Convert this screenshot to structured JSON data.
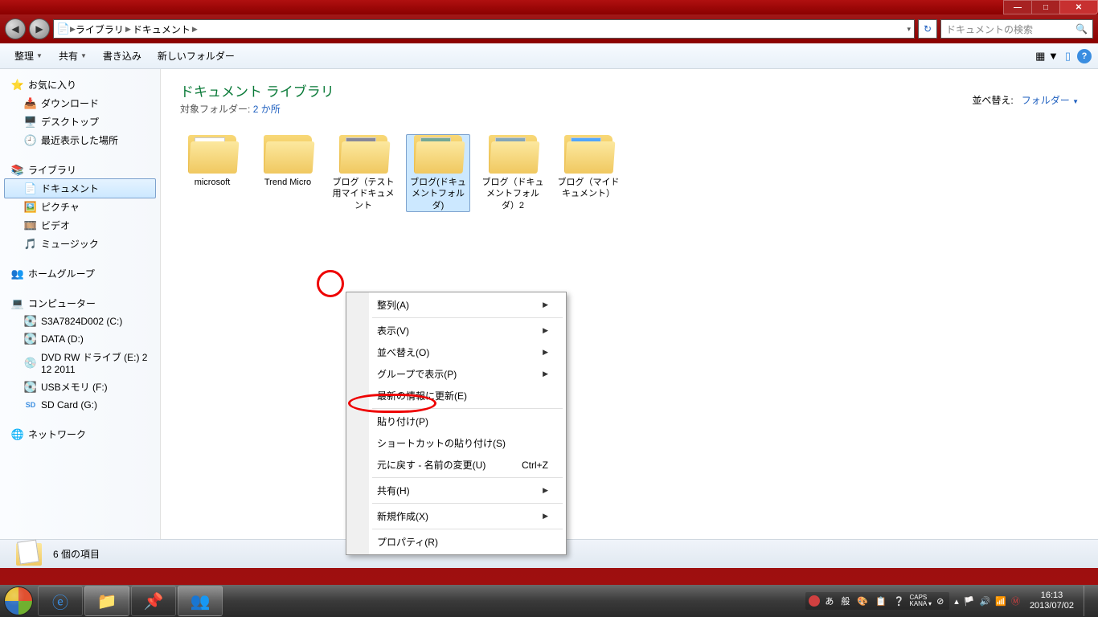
{
  "window_controls": {
    "min": "—",
    "max": "□",
    "close": "✕"
  },
  "nav": {
    "back": "◀",
    "fwd": "▶"
  },
  "breadcrumb": [
    "ライブラリ",
    "ドキュメント"
  ],
  "search_placeholder": "ドキュメントの検索",
  "toolbar": {
    "organize": "整理",
    "share": "共有",
    "burn": "書き込み",
    "newfolder": "新しいフォルダー"
  },
  "sidebar": {
    "favorites": {
      "label": "お気に入り",
      "items": [
        "ダウンロード",
        "デスクトップ",
        "最近表示した場所"
      ]
    },
    "libraries": {
      "label": "ライブラリ",
      "items": [
        "ドキュメント",
        "ピクチャ",
        "ビデオ",
        "ミュージック"
      ]
    },
    "homegroup": "ホームグループ",
    "computer": {
      "label": "コンピューター",
      "items": [
        "S3A7824D002 (C:)",
        "DATA (D:)",
        "DVD RW ドライブ (E:) 2 12 2011",
        "USBメモリ (F:)",
        "SD Card (G:)"
      ]
    },
    "network": "ネットワーク"
  },
  "library": {
    "title": "ドキュメント ライブラリ",
    "subtitle_label": "対象フォルダー:",
    "subtitle_link": "2 か所",
    "sort_label": "並べ替え:",
    "sort_value": "フォルダー"
  },
  "folders": [
    {
      "name": "microsoft"
    },
    {
      "name": "Trend Micro"
    },
    {
      "name": "ブログ（テスト用マイドキュメント"
    },
    {
      "name": "ブログ(ドキュメントフォルダ)"
    },
    {
      "name": "ブログ（ドキュメントフォルダ）2"
    },
    {
      "name": "ブログ（マイドキュメント）"
    }
  ],
  "contextmenu": {
    "arrange": "整列(A)",
    "view": "表示(V)",
    "sort": "並べ替え(O)",
    "group": "グループで表示(P)",
    "refresh": "最新の情報に更新(E)",
    "paste": "貼り付け(P)",
    "paste_shortcut": "ショートカットの貼り付け(S)",
    "undo": "元に戻す - 名前の変更(U)",
    "undo_key": "Ctrl+Z",
    "sharewith": "共有(H)",
    "new": "新規作成(X)",
    "properties": "プロパティ(R)"
  },
  "statusbar": {
    "text": "6 個の項目"
  },
  "ime": {
    "a": "あ",
    "han": "般",
    "caps": "CAPS",
    "kana": "KANA"
  },
  "clock": {
    "time": "16:13",
    "date": "2013/07/02"
  }
}
